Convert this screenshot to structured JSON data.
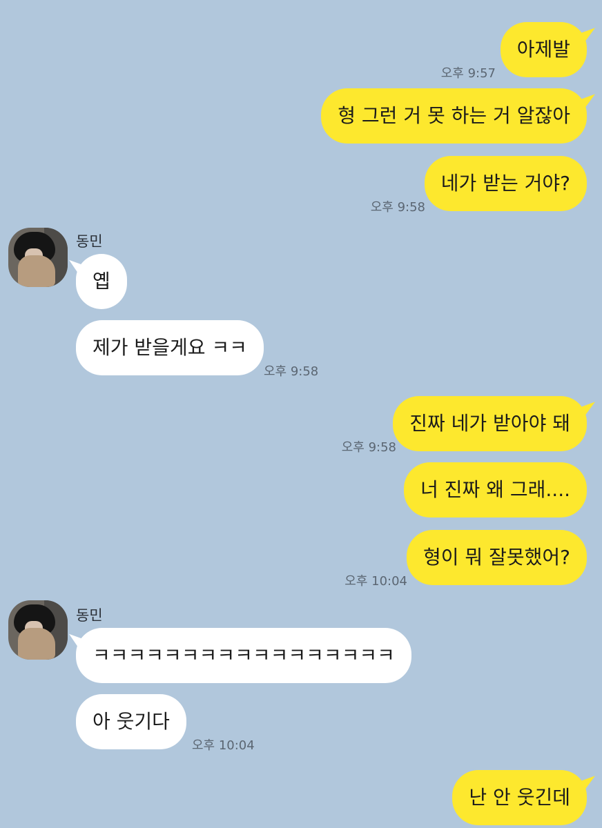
{
  "contact": {
    "name": "동민"
  },
  "messages": [
    {
      "text": "아제발"
    },
    {
      "time": "오후 9:57"
    },
    {
      "text": "형 그런 거 못 하는 거 알잖아"
    },
    {
      "text": "네가 받는 거야?"
    },
    {
      "time": "오후 9:58"
    },
    {
      "text": "옙"
    },
    {
      "text": "제가 받을게요 ㅋㅋ"
    },
    {
      "time": "오후 9:58"
    },
    {
      "text": "진짜 네가 받아야 돼"
    },
    {
      "time": "오후 9:58"
    },
    {
      "text": "너 진짜 왜 그래...."
    },
    {
      "text": "형이 뭐 잘못했어?"
    },
    {
      "time": "오후 10:04"
    },
    {
      "text": "ㅋㅋㅋㅋㅋㅋㅋㅋㅋㅋㅋㅋㅋㅋㅋㅋㅋ"
    },
    {
      "text": "아 웃기다"
    },
    {
      "time": "오후 10:04"
    },
    {
      "text": "난 안 웃긴데"
    }
  ],
  "colors": {
    "background": "#b1c7dc",
    "mine": "#fde82e",
    "theirs": "#ffffff"
  }
}
